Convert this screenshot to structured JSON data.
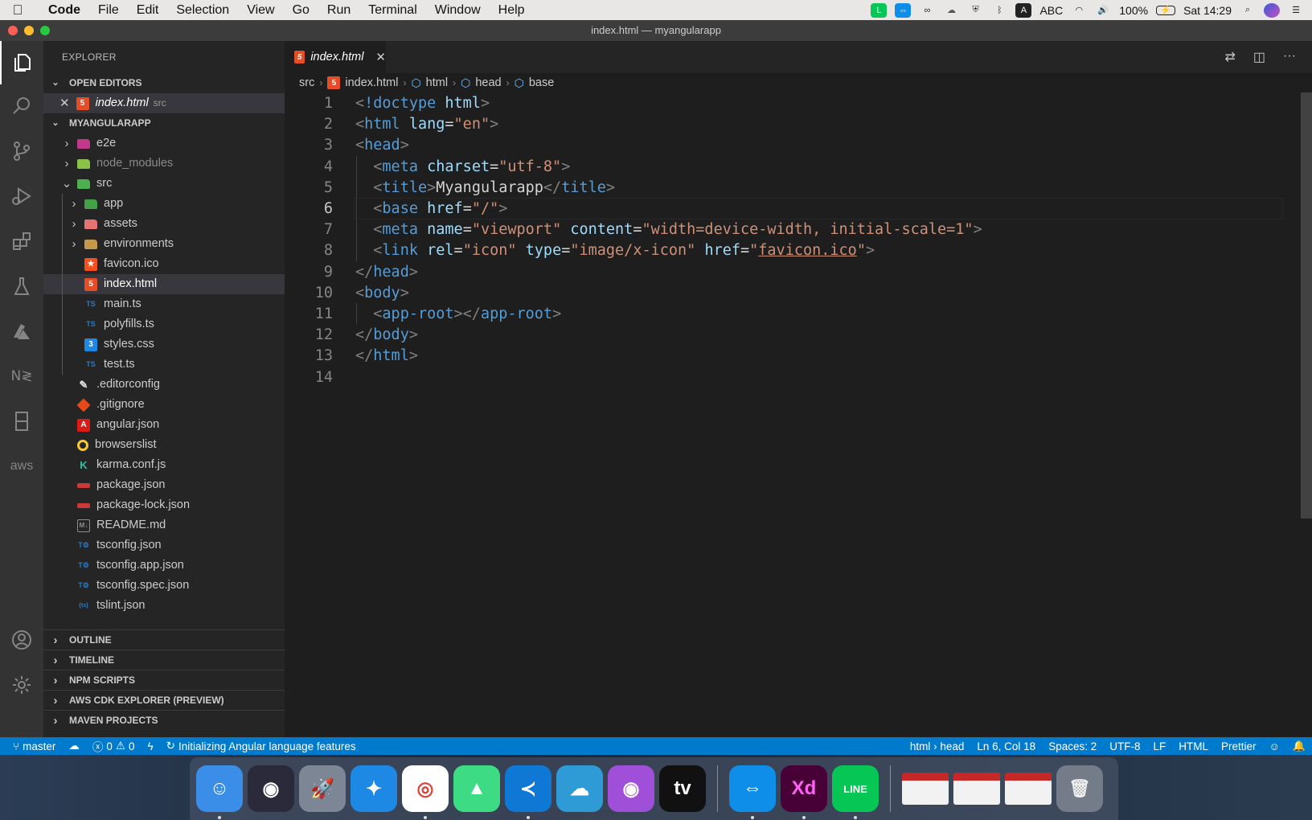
{
  "menubar": {
    "app": "Code",
    "items": [
      "File",
      "Edit",
      "Selection",
      "View",
      "Go",
      "Run",
      "Terminal",
      "Window",
      "Help"
    ],
    "status": {
      "input": "ABC",
      "battery": "100%",
      "clock": "Sat 14:29"
    }
  },
  "window": {
    "title": "index.html — myangularapp"
  },
  "sidebar": {
    "title": "EXPLORER",
    "open_editors_label": "OPEN EDITORS",
    "open_editor": {
      "name": "index.html",
      "dir": "src"
    },
    "project_label": "MYANGULARAPP",
    "tree": [
      {
        "name": "e2e",
        "icon": "folder-e2e-icon",
        "icolor": "#c0398a",
        "level": 0,
        "folder": true,
        "open": false
      },
      {
        "name": "node_modules",
        "icon": "folder-node-icon",
        "icolor": "#8bc34a",
        "level": 0,
        "folder": true,
        "open": false,
        "dim": true
      },
      {
        "name": "src",
        "icon": "folder-src-icon",
        "icolor": "#4caf50",
        "level": 0,
        "folder": true,
        "open": true
      },
      {
        "name": "app",
        "icon": "folder-app-icon",
        "icolor": "#43a047",
        "level": 1,
        "folder": true,
        "open": false
      },
      {
        "name": "assets",
        "icon": "folder-assets-icon",
        "icolor": "#e57373",
        "level": 1,
        "folder": true,
        "open": false
      },
      {
        "name": "environments",
        "icon": "folder-icon",
        "icolor": "#c49a4a",
        "level": 1,
        "folder": true,
        "open": false
      },
      {
        "name": "favicon.ico",
        "icon": "favicon-icon",
        "icolor": "#f4511e",
        "level": 1
      },
      {
        "name": "index.html",
        "icon": "html-icon",
        "icolor": "#e44d26",
        "level": 1,
        "selected": true
      },
      {
        "name": "main.ts",
        "icon": "ts-icon",
        "icolor": "#2b7bc0",
        "level": 1
      },
      {
        "name": "polyfills.ts",
        "icon": "ts-icon",
        "icolor": "#2b7bc0",
        "level": 1
      },
      {
        "name": "styles.css",
        "icon": "css-icon",
        "icolor": "#1e88e5",
        "level": 1
      },
      {
        "name": "test.ts",
        "icon": "ts-icon",
        "icolor": "#2b7bc0",
        "level": 1
      },
      {
        "name": ".editorconfig",
        "icon": "editorconfig-icon",
        "icolor": "#e0e0e0",
        "level": 0
      },
      {
        "name": ".gitignore",
        "icon": "git-icon",
        "icolor": "#e64a19",
        "level": 0
      },
      {
        "name": "angular.json",
        "icon": "angular-icon",
        "icolor": "#dd1b16",
        "level": 0
      },
      {
        "name": "browserslist",
        "icon": "browserslist-icon",
        "icolor": "#f9c933",
        "level": 0
      },
      {
        "name": "karma.conf.js",
        "icon": "karma-icon",
        "icolor": "#3cbe9f",
        "level": 0
      },
      {
        "name": "package.json",
        "icon": "npm-icon",
        "icolor": "#cb3837",
        "level": 0
      },
      {
        "name": "package-lock.json",
        "icon": "npm-icon",
        "icolor": "#cb3837",
        "level": 0
      },
      {
        "name": "README.md",
        "icon": "markdown-icon",
        "icolor": "#8c8c8c",
        "level": 0
      },
      {
        "name": "tsconfig.json",
        "icon": "tsconfig-icon",
        "icolor": "#2b7bc0",
        "level": 0
      },
      {
        "name": "tsconfig.app.json",
        "icon": "tsconfig-icon",
        "icolor": "#2b7bc0",
        "level": 0
      },
      {
        "name": "tsconfig.spec.json",
        "icon": "tsconfig-icon",
        "icolor": "#2b7bc0",
        "level": 0
      },
      {
        "name": "tslint.json",
        "icon": "tslint-icon",
        "icolor": "#2b7bc0",
        "level": 0
      }
    ],
    "bottom_sections": [
      "OUTLINE",
      "TIMELINE",
      "NPM SCRIPTS",
      "AWS CDK EXPLORER (PREVIEW)",
      "MAVEN PROJECTS"
    ]
  },
  "editor": {
    "tab": "index.html",
    "breadcrumb": [
      "src",
      "index.html",
      "html",
      "head",
      "base"
    ],
    "current_line": 6,
    "lines": [
      [
        [
          "p",
          "<"
        ],
        [
          "t",
          "!doctype"
        ],
        [
          "w",
          " "
        ],
        [
          "a",
          "html"
        ],
        [
          "p",
          ">"
        ]
      ],
      [
        [
          "p",
          "<"
        ],
        [
          "t",
          "html"
        ],
        [
          "w",
          " "
        ],
        [
          "a",
          "lang"
        ],
        [
          "w",
          "="
        ],
        [
          "s",
          "\"en\""
        ],
        [
          "p",
          ">"
        ]
      ],
      [
        [
          "p",
          "<"
        ],
        [
          "t",
          "head"
        ],
        [
          "p",
          ">"
        ]
      ],
      [
        [
          "w",
          "  "
        ],
        [
          "p",
          "<"
        ],
        [
          "t",
          "meta"
        ],
        [
          "w",
          " "
        ],
        [
          "a",
          "charset"
        ],
        [
          "w",
          "="
        ],
        [
          "s",
          "\"utf-8\""
        ],
        [
          "p",
          ">"
        ]
      ],
      [
        [
          "w",
          "  "
        ],
        [
          "p",
          "<"
        ],
        [
          "t",
          "title"
        ],
        [
          "p",
          ">"
        ],
        [
          "w",
          "Myangularapp"
        ],
        [
          "p",
          "</"
        ],
        [
          "t",
          "title"
        ],
        [
          "p",
          ">"
        ]
      ],
      [
        [
          "w",
          "  "
        ],
        [
          "p",
          "<"
        ],
        [
          "t",
          "base"
        ],
        [
          "w",
          " "
        ],
        [
          "a",
          "href"
        ],
        [
          "w",
          "="
        ],
        [
          "s",
          "\"/\""
        ],
        [
          "p",
          ">"
        ]
      ],
      [
        [
          "w",
          "  "
        ],
        [
          "p",
          "<"
        ],
        [
          "t",
          "meta"
        ],
        [
          "w",
          " "
        ],
        [
          "a",
          "name"
        ],
        [
          "w",
          "="
        ],
        [
          "s",
          "\"viewport\""
        ],
        [
          "w",
          " "
        ],
        [
          "a",
          "content"
        ],
        [
          "w",
          "="
        ],
        [
          "s",
          "\"width=device-width, initial-scale=1\""
        ],
        [
          "p",
          ">"
        ]
      ],
      [
        [
          "w",
          "  "
        ],
        [
          "p",
          "<"
        ],
        [
          "t",
          "link"
        ],
        [
          "w",
          " "
        ],
        [
          "a",
          "rel"
        ],
        [
          "w",
          "="
        ],
        [
          "s",
          "\"icon\""
        ],
        [
          "w",
          " "
        ],
        [
          "a",
          "type"
        ],
        [
          "w",
          "="
        ],
        [
          "s",
          "\"image/x-icon\""
        ],
        [
          "w",
          " "
        ],
        [
          "a",
          "href"
        ],
        [
          "w",
          "="
        ],
        [
          "s",
          "\""
        ],
        [
          "su",
          "favicon.ico"
        ],
        [
          "s",
          "\""
        ],
        [
          "p",
          ">"
        ]
      ],
      [
        [
          "p",
          "</"
        ],
        [
          "t",
          "head"
        ],
        [
          "p",
          ">"
        ]
      ],
      [
        [
          "p",
          "<"
        ],
        [
          "t",
          "body"
        ],
        [
          "p",
          ">"
        ]
      ],
      [
        [
          "w",
          "  "
        ],
        [
          "p",
          "<"
        ],
        [
          "t",
          "app-root"
        ],
        [
          "p",
          "></"
        ],
        [
          "t",
          "app-root"
        ],
        [
          "p",
          ">"
        ]
      ],
      [
        [
          "p",
          "</"
        ],
        [
          "t",
          "body"
        ],
        [
          "p",
          ">"
        ]
      ],
      [
        [
          "p",
          "</"
        ],
        [
          "t",
          "html"
        ],
        [
          "p",
          ">"
        ]
      ],
      []
    ]
  },
  "statusbar": {
    "branch": "master",
    "errors": "0",
    "warnings": "0",
    "message": "Initializing Angular language features",
    "right": [
      "html › head",
      "Ln 6, Col 18",
      "Spaces: 2",
      "UTF-8",
      "LF",
      "HTML",
      "Prettier"
    ]
  },
  "dock": {
    "apps": [
      {
        "name": "finder-icon",
        "color": "#3b8ee8",
        "glyph": "☺",
        "running": true
      },
      {
        "name": "siri-icon",
        "color": "#2a2a3a",
        "glyph": "◉"
      },
      {
        "name": "launchpad-icon",
        "color": "#7d8694",
        "glyph": "🚀"
      },
      {
        "name": "safari-icon",
        "color": "#1e88e5",
        "glyph": "✦"
      },
      {
        "name": "chrome-icon",
        "color": "#ffffff",
        "glyph": "◎",
        "running": true
      },
      {
        "name": "android-studio-icon",
        "color": "#3ddc84",
        "glyph": "▲"
      },
      {
        "name": "vscode-icon",
        "color": "#0e78d4",
        "glyph": "≺",
        "running": true
      },
      {
        "name": "azure-data-studio-icon",
        "color": "#2e9bd6",
        "glyph": "☁"
      },
      {
        "name": "podcasts-icon",
        "color": "#a050d8",
        "glyph": "◉"
      },
      {
        "name": "apple-tv-icon",
        "color": "#111111",
        "glyph": "tv"
      },
      {
        "name": "teamviewer-icon",
        "color": "#0e8ee9",
        "glyph": "⇔",
        "running": true
      },
      {
        "name": "adobe-xd-icon",
        "color": "#470137",
        "glyph": "Xd",
        "fg": "#ff61f6",
        "running": true
      },
      {
        "name": "line-icon",
        "color": "#06c755",
        "glyph": "LINE",
        "running": true
      }
    ],
    "windows": [
      "window-thumbnail-1",
      "window-thumbnail-2",
      "window-thumbnail-3"
    ],
    "trash": "trash-icon"
  },
  "colors": {
    "accent": "#007acc",
    "activity": "#333333",
    "sidebar": "#252526",
    "editor": "#1e1e1e"
  }
}
